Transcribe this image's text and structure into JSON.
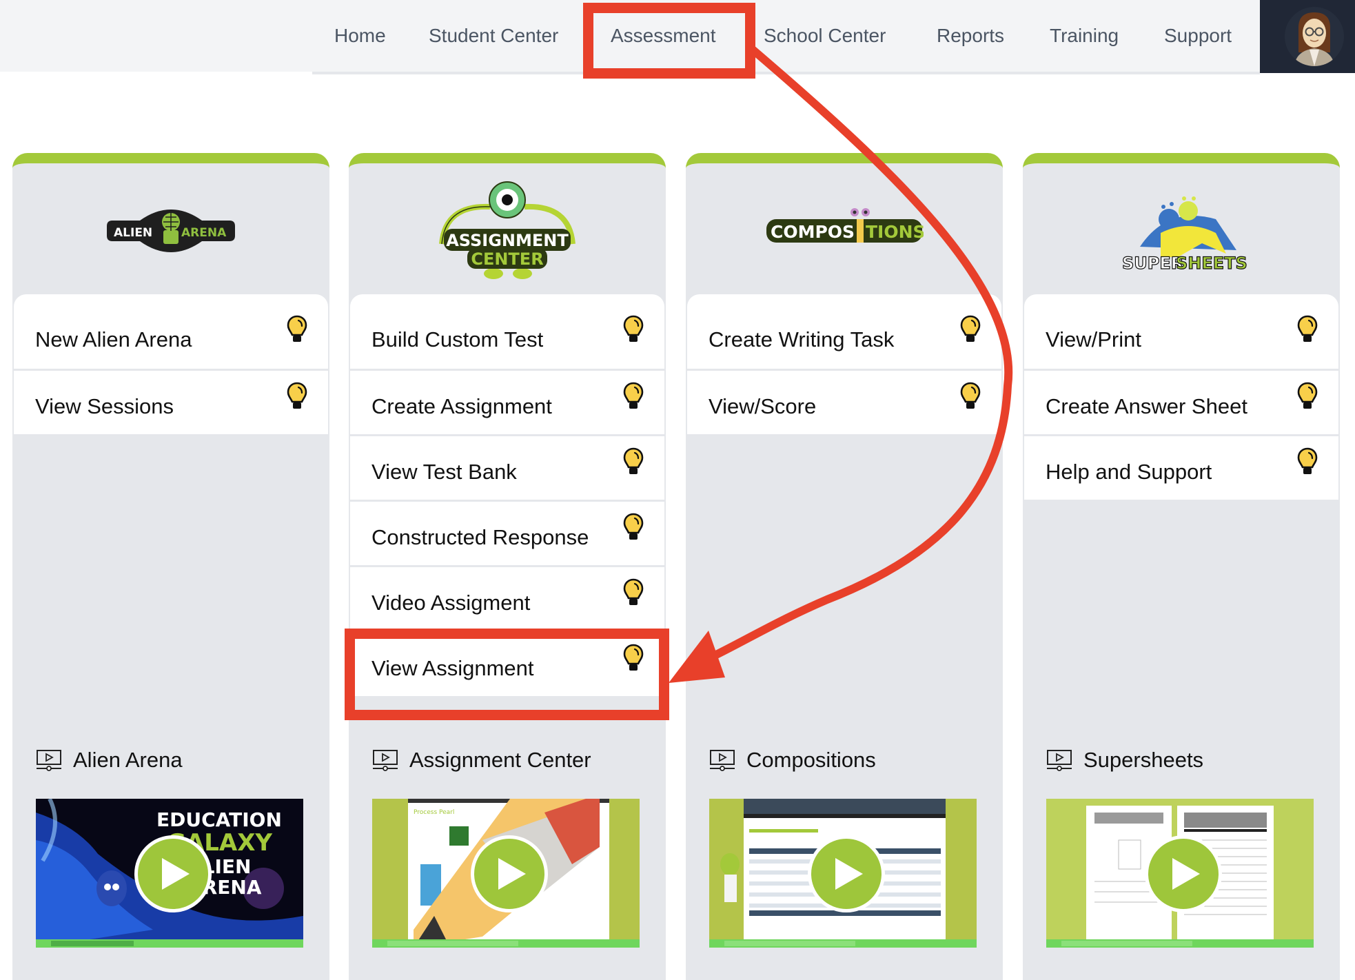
{
  "nav": {
    "items": [
      {
        "label": "Home"
      },
      {
        "label": "Student Center"
      },
      {
        "label": "Assessment"
      },
      {
        "label": "School Center"
      },
      {
        "label": "Reports"
      },
      {
        "label": "Training"
      },
      {
        "label": "Support"
      }
    ],
    "active": "Assessment",
    "avatar_icon": "user-avatar-icon"
  },
  "cards": [
    {
      "id": "alien-arena",
      "logo_text": [
        "ALIEN",
        "ARENA"
      ],
      "items": [
        {
          "label": "New Alien Arena",
          "icon": "lightbulb-icon"
        },
        {
          "label": "View Sessions",
          "icon": "lightbulb-icon"
        }
      ],
      "video": {
        "title": "Alien Arena",
        "icon": "video-play-icon",
        "thumb_text": [
          "EDUCATION",
          "GALAXY",
          "ALIEN",
          "ARENA"
        ]
      }
    },
    {
      "id": "assignment-center",
      "logo_text": [
        "ASSIGNMENT",
        "CENTER"
      ],
      "items": [
        {
          "label": "Build Custom Test",
          "icon": "lightbulb-icon"
        },
        {
          "label": "Create Assignment",
          "icon": "lightbulb-icon"
        },
        {
          "label": "View Test Bank",
          "icon": "lightbulb-icon"
        },
        {
          "label": "Constructed Response",
          "icon": "lightbulb-icon"
        },
        {
          "label": "Video Assigment",
          "icon": "lightbulb-icon"
        },
        {
          "label": "View Assignment",
          "icon": "lightbulb-icon"
        }
      ],
      "video": {
        "title": "Assignment Center",
        "icon": "video-play-icon"
      }
    },
    {
      "id": "compositions",
      "logo_text": [
        "COMPOS",
        "TIONS"
      ],
      "items": [
        {
          "label": "Create Writing Task",
          "icon": "lightbulb-icon"
        },
        {
          "label": "View/Score",
          "icon": "lightbulb-icon"
        }
      ],
      "video": {
        "title": "Compositions",
        "icon": "video-play-icon"
      }
    },
    {
      "id": "supersheets",
      "logo_text": [
        "SUPER",
        "SHEETS"
      ],
      "items": [
        {
          "label": "View/Print",
          "icon": "lightbulb-icon"
        },
        {
          "label": "Create Answer Sheet",
          "icon": "lightbulb-icon"
        },
        {
          "label": "Help and Support",
          "icon": "lightbulb-icon"
        }
      ],
      "video": {
        "title": "Supersheets",
        "icon": "video-play-icon"
      }
    }
  ],
  "annotations": {
    "highlight_nav": "Assessment",
    "highlight_item": "View Assignment",
    "color": "#e8402a"
  },
  "colors": {
    "accent_green": "#a3c93a",
    "card_bg": "#e5e7eb",
    "nav_bg": "#f3f4f6",
    "nav_text": "#4b5563",
    "avatar_bg": "#202736",
    "bulb_yellow": "#f8cf4a"
  }
}
